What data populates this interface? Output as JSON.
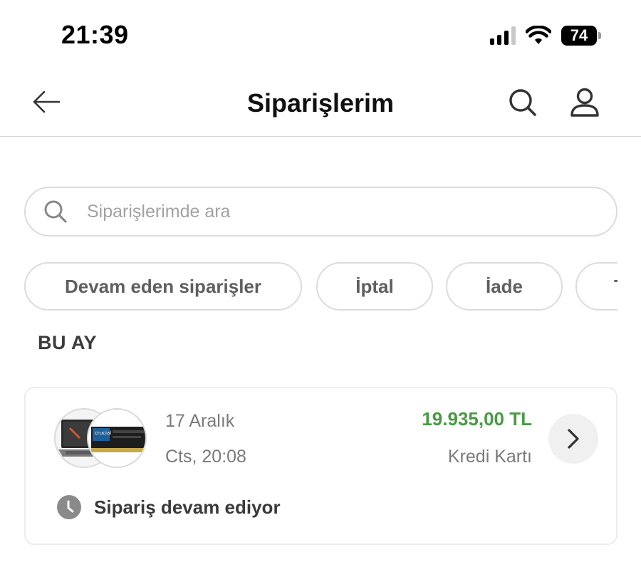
{
  "status_bar": {
    "time": "21:39",
    "battery": "74",
    "icons": [
      "signal-icon",
      "wifi-icon",
      "battery-icon"
    ]
  },
  "header": {
    "title": "Siparişlerim",
    "icons": [
      "back-arrow-icon",
      "search-icon",
      "user-icon"
    ]
  },
  "search": {
    "placeholder": "Siparişlerimde ara",
    "value": ""
  },
  "filters": [
    {
      "label": "Devam eden siparişler"
    },
    {
      "label": "İptal"
    },
    {
      "label": "İade"
    },
    {
      "label": "T"
    }
  ],
  "section": {
    "title": "BU AY"
  },
  "orders": [
    {
      "date": "17 Aralık",
      "time": "Cts, 20:08",
      "price": "19.935,00 TL",
      "payment": "Kredi Kartı",
      "status": "Sipariş devam ediyor",
      "status_icon": "clock-icon",
      "thumbnails": [
        "laptop-thumbnail",
        "ram-module-thumbnail"
      ],
      "thumbnail_text": "crucial"
    }
  ],
  "colors": {
    "price": "#4a9a45",
    "border": "#dcdcdc",
    "muted_text": "#7a7a7a"
  }
}
